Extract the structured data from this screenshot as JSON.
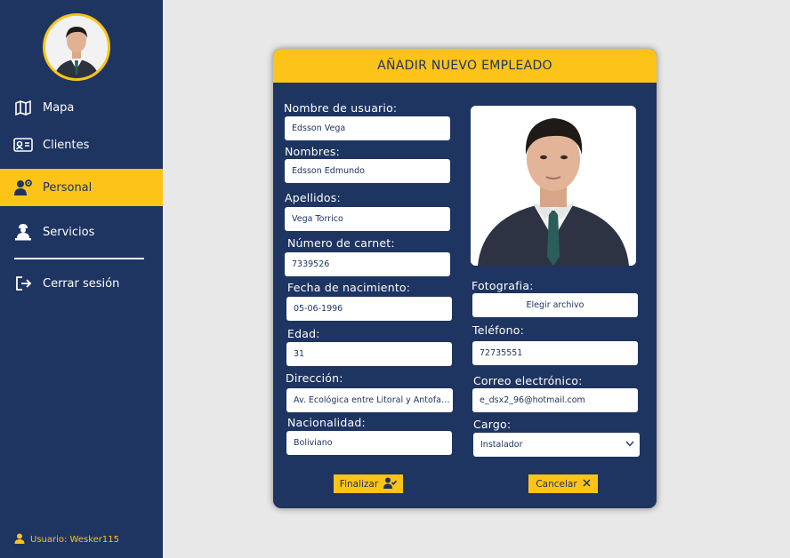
{
  "sidebar": {
    "items": [
      {
        "label": "Mapa",
        "icon": "map-icon"
      },
      {
        "label": "Clientes",
        "icon": "id-card-icon"
      },
      {
        "label": "Personal",
        "icon": "users-gear-icon"
      },
      {
        "label": "Servicios",
        "icon": "worker-icon"
      }
    ],
    "logout_label": "Cerrar sesión",
    "user_label": "Usuario: Wesker115"
  },
  "form": {
    "title": "AÑADIR NUEVO EMPLEADO",
    "username_label": "Nombre de usuario:",
    "username_value": "Edsson Vega",
    "names_label": "Nombres:",
    "names_value": "Edsson Edmundo",
    "surnames_label": "Apellidos:",
    "surnames_value": "Vega Torrico",
    "carnet_label": "Número de carnet:",
    "carnet_value": "7339526",
    "birth_label": "Fecha de nacimiento:",
    "birth_value": "05-06-1996",
    "age_label": "Edad:",
    "age_value": "31",
    "address_label": "Dirección:",
    "address_value": "Av. Ecológica entre Litoral y Antofagasta",
    "nationality_label": "Nacionalidad:",
    "nationality_value": "Boliviano",
    "photo_label": "Fotografia:",
    "photo_button": "Elegir archivo",
    "phone_label": "Teléfono:",
    "phone_value": "72735551",
    "email_label": "Correo electrónico:",
    "email_value": "e_dsx2_96@hotmail.com",
    "role_label": "Cargo:",
    "role_value": "Instalador",
    "finish_button": "Finalizar",
    "cancel_button": "Cancelar"
  },
  "colors": {
    "sidebar": "#1e3461",
    "accent": "#fcc419",
    "background": "#e8e8e8"
  }
}
